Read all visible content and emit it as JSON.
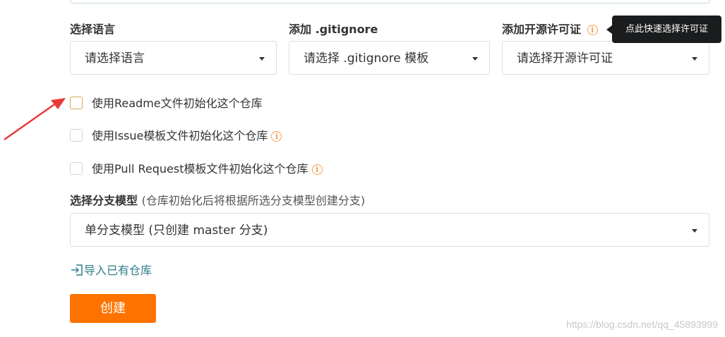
{
  "language": {
    "label": "选择语言",
    "value": "请选择语言"
  },
  "gitignore": {
    "label": "添加 .gitignore",
    "value": "请选择 .gitignore 模板"
  },
  "license": {
    "label": "添加开源许可证",
    "value": "请选择开源许可证",
    "tooltip": "点此快速选择许可证"
  },
  "init_options": [
    {
      "label": "使用Readme文件初始化这个仓库",
      "checked": false
    },
    {
      "label": "使用Issue模板文件初始化这个仓库",
      "checked": false
    },
    {
      "label": "使用Pull Request模板文件初始化这个仓库",
      "checked": false
    }
  ],
  "branch": {
    "label": "选择分支模型",
    "hint": "(仓库初始化后将根据所选分支模型创建分支)",
    "value": "单分支模型 (只创建 master 分支)"
  },
  "import_link": "导入已有仓库",
  "create_button": "创建",
  "watermark": "https://blog.csdn.net/qq_45893999",
  "colors": {
    "primary_button": "#fe7300",
    "info_icon": "#f5a04b",
    "link": "#2f7d8c",
    "tooltip_bg": "#1b1c1d",
    "arrow": "#e8393a"
  },
  "icons": {
    "info": "info-circle-icon",
    "dropdown": "caret-down-icon",
    "import": "sign-in-icon"
  }
}
